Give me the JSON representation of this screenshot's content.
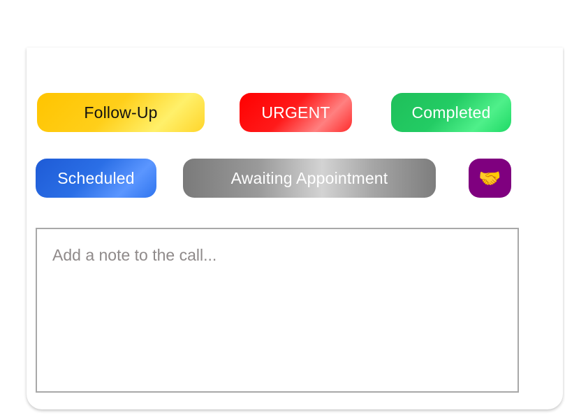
{
  "tags": {
    "follow_up": "Follow-Up",
    "urgent": "URGENT",
    "completed": "Completed",
    "scheduled": "Scheduled",
    "awaiting": "Awaiting Appointment",
    "handshake": "🤝"
  },
  "note": {
    "value": "",
    "placeholder": "Add a note to the call..."
  },
  "colors": {
    "follow_up": "#ffc400",
    "urgent": "#ff0000",
    "completed": "#1fbf5a",
    "scheduled": "#1e5bd6",
    "awaiting": "#9a9a9a",
    "handshake_bg": "#7f007f",
    "note_border": "#a8a8a8"
  },
  "icons": {
    "handshake": "handshake-icon"
  }
}
